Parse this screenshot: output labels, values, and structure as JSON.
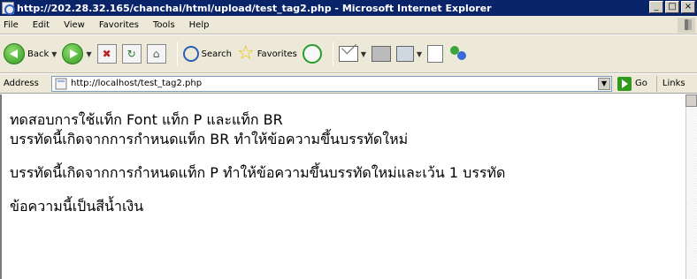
{
  "window": {
    "title": "http://202.28.32.165/chanchai/html/upload/test_tag2.php - Microsoft Internet Explorer",
    "minimize": "_",
    "maximize": "□",
    "close": "×"
  },
  "menu": [
    "File",
    "Edit",
    "View",
    "Favorites",
    "Tools",
    "Help"
  ],
  "toolbar": {
    "back_label": "Back",
    "search_label": "Search",
    "favorites_label": "Favorites"
  },
  "address": {
    "label": "Address",
    "url": "http://localhost/test_tag2.php",
    "go_label": "Go",
    "links_label": "Links"
  },
  "content": {
    "line1": "ทดสอบการใช้แท็ก Font แท็ก P และแท็ก BR",
    "line2": "บรรทัดนี้เกิดจากการกำหนดแท็ก BR ทำให้ข้อความขึ้นบรรทัดใหม่",
    "line3": "บรรทัดนี้เกิดจากการกำหนดแท็ก P ทำให้ข้อความขึ้นบรรทัดใหม่และเว้น 1 บรรทัด",
    "line4": "ข้อความนี้เป็นสีน้ำเงิน"
  }
}
